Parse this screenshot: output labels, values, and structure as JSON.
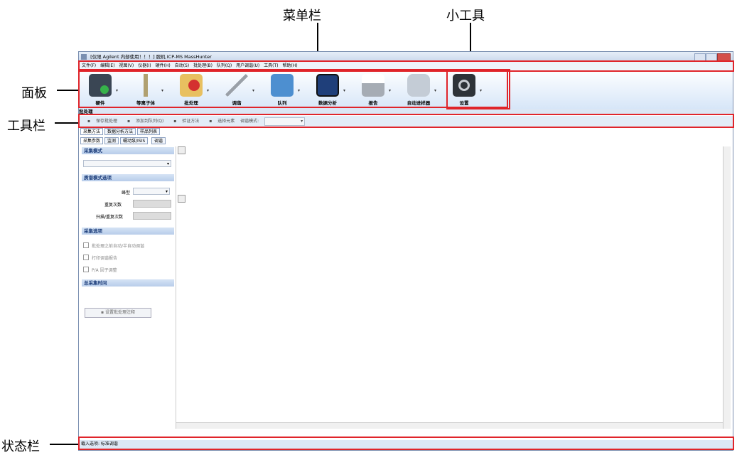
{
  "annotations": {
    "menubar": "菜单栏",
    "widgets": "小工具",
    "panel": "面板",
    "toolbar": "工具栏",
    "statusbar": "状态栏"
  },
  "window": {
    "title": "[仅限 Agilent 内部使用！！！] 脱机 ICP-MS MassHunter"
  },
  "menu": [
    "文件(F)",
    "编辑(E)",
    "视图(V)",
    "仪器(I)",
    "硬件(H)",
    "自动(S)",
    "批处理(B)",
    "队列(Q)",
    "用户调谐(U)",
    "工具(T)",
    "帮助(H)"
  ],
  "panel_buttons": [
    {
      "label": "硬件",
      "icon": "wrench-check-icon"
    },
    {
      "label": "等离子体",
      "icon": "plasma-torch-icon"
    },
    {
      "label": "批处理",
      "icon": "batch-folder-icon"
    },
    {
      "label": "调谐",
      "icon": "tune-pens-icon"
    },
    {
      "label": "队列",
      "icon": "queue-list-icon"
    },
    {
      "label": "数据分析",
      "icon": "data-analysis-monitor-icon"
    },
    {
      "label": "报告",
      "icon": "printer-icon"
    },
    {
      "label": "自动进样器",
      "icon": "autosampler-icon"
    },
    {
      "label": "设置",
      "icon": "gear-icon"
    }
  ],
  "section_title": "批处理",
  "toolbar": {
    "save": "保存批处理",
    "add_queue": "添加到队列(Q)",
    "validate": "验证方法",
    "select_elements": "选择元素",
    "tune_mode_label": "调谐模式:"
  },
  "tabs_row1": [
    "采集方法",
    "数据分析方法",
    "样品列表"
  ],
  "tabs_row2": [
    "采集参数",
    "监测",
    "蠕动泵/ISIS",
    "调谐"
  ],
  "left_panel": {
    "acq_mode_header": "采集模式",
    "spectrum_options_header": "质谱模式选项",
    "peak_type_label": "峰型",
    "replicates_label": "重复次数",
    "sweeps_label": "扫描/重复次数",
    "acq_options_header": "采集选项",
    "opt1": "批处理之前自动/半自动调谐",
    "opt2": "打印调谐报告",
    "opt3": "P/A 因子调整",
    "total_time_header": "总采集时间",
    "annotation_button": "设置批处理注释"
  },
  "status": {
    "text": "载入选项: 标准调谐"
  }
}
